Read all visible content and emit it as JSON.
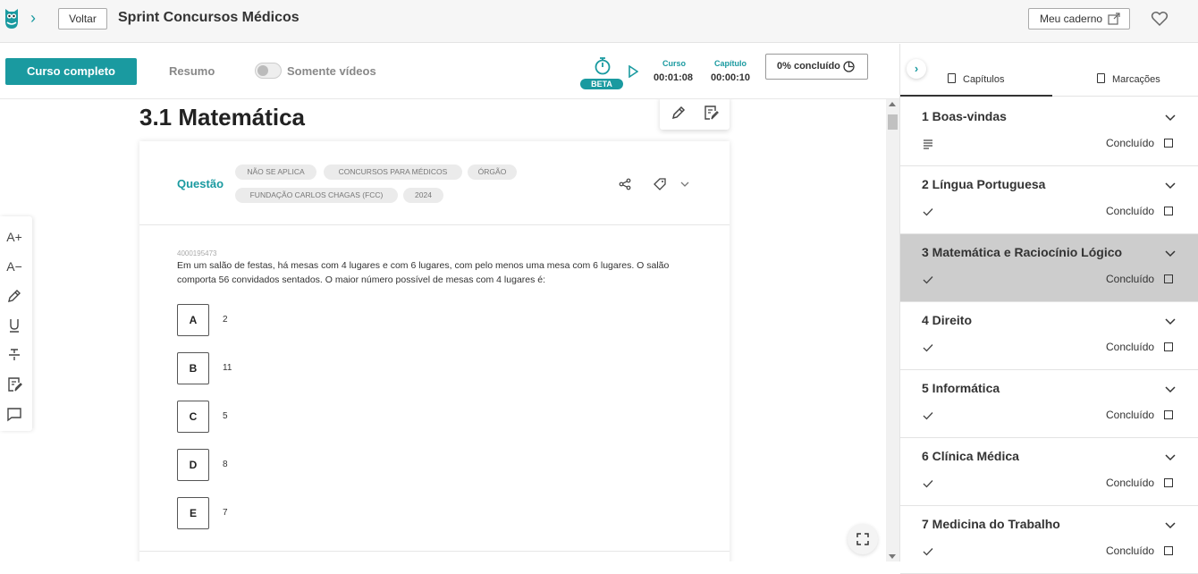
{
  "header": {
    "back_label": "Voltar",
    "title": "Sprint Concursos Médicos",
    "notebook_label": "Meu caderno"
  },
  "toolbar": {
    "full_course_label": "Curso completo",
    "summary_label": "Resumo",
    "videos_only_label": "Somente vídeos",
    "beta_label": "BETA",
    "course_label": "Curso",
    "course_time": "00:01:08",
    "chapter_label": "Capítulo",
    "chapter_time": "00:00:10",
    "completed_label": "0% concluído"
  },
  "main": {
    "chapter_title": "3.1 Matemática",
    "question": {
      "label": "Questão",
      "tags": [
        "NÃO SE APLICA",
        "CONCURSOS PARA MÉDICOS",
        "ÓRGÃO",
        "FUNDAÇÃO CARLOS CHAGAS (FCC)",
        "2024"
      ],
      "id": "4000195473",
      "text": "Em um salão de festas, há mesas com 4 lugares e com 6 lugares, com pelo menos uma mesa com 6 lugares. O salão comporta 56 convidados sentados. O maior número possível de mesas com 4 lugares é:",
      "options": [
        {
          "letter": "A",
          "value": "2"
        },
        {
          "letter": "B",
          "value": "11"
        },
        {
          "letter": "C",
          "value": "5"
        },
        {
          "letter": "D",
          "value": "8"
        },
        {
          "letter": "E",
          "value": "7"
        }
      ]
    },
    "left_tools": [
      "A+",
      "A−"
    ]
  },
  "sidebar": {
    "tabs": [
      {
        "label": "Capítulos"
      },
      {
        "label": "Marcações"
      }
    ],
    "chapters": [
      {
        "name": "1 Boas-vindas",
        "status": "Concluído",
        "icon": "lines-icon",
        "active": false
      },
      {
        "name": "2 Língua Portuguesa",
        "status": "Concluído",
        "icon": "check-icon",
        "active": false
      },
      {
        "name": "3 Matemática e Raciocínio Lógico",
        "status": "Concluído",
        "icon": "check-icon",
        "active": true
      },
      {
        "name": "4 Direito",
        "status": "Concluído",
        "icon": "check-icon",
        "active": false
      },
      {
        "name": "5 Informática",
        "status": "Concluído",
        "icon": "check-icon",
        "active": false
      },
      {
        "name": "6 Clínica Médica",
        "status": "Concluído",
        "icon": "check-icon",
        "active": false
      },
      {
        "name": "7 Medicina do Trabalho",
        "status": "Concluído",
        "icon": "check-icon",
        "active": false
      }
    ]
  },
  "colors": {
    "accent": "#1a9aa0",
    "active_row": "#cdcdcd"
  }
}
